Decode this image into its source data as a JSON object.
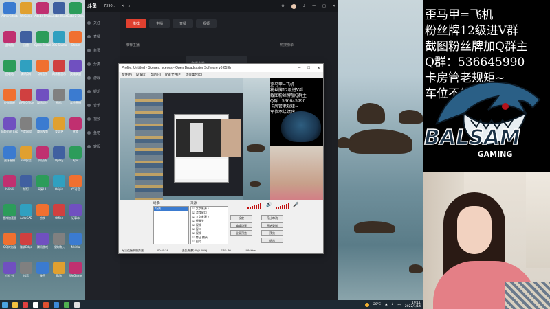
{
  "overlay": {
    "lines": [
      "歪马甲=飞机",
      "粉丝牌12级进V群",
      "截图粉丝牌加Q群主",
      "Q群：536645990",
      "卡房管老规矩~",
      "车位不给嫖哼"
    ],
    "logo_text": "BALSAM",
    "logo_sub": "GAMING"
  },
  "app": {
    "logo": "斗鱼",
    "title_code": "7390...",
    "sidebar": [
      "关注",
      "直播",
      "首页",
      "分类",
      "游戏",
      "娱乐",
      "音乐",
      "视频",
      "鱼吧",
      "客服"
    ],
    "tabs": [
      "推荐",
      "主播",
      "直播",
      "视频"
    ],
    "section_label": "推荐主播",
    "card_label": "自媒小桃",
    "right_label": "热搜榜单"
  },
  "obs": {
    "title": "Profile: Untitled - Scenes: scenes - Open Broadcaster Software v0.659b",
    "menu": [
      "文件(F)",
      "设置(S)",
      "帮助(H)",
      "配置文件(P)",
      "场景集合(C)"
    ],
    "scenes_label": "场景:",
    "sources_label": "来源:",
    "scenes": [
      "场景"
    ],
    "sources": [
      "文字来源 1",
      "游戏窗口",
      "文字来源 2",
      "摄像头",
      "视频",
      "窗口",
      "视频",
      "特征 捕获",
      "图片"
    ],
    "buttons": [
      "设定",
      "停止串流",
      "编辑场景",
      "开始录制",
      "全屏预览",
      "预览",
      "退出"
    ],
    "status": [
      "无法连接到服务器",
      "00:40:24",
      "丢失 帧数: 0 (0.00%)",
      "FPS: 30",
      "1094kb/s"
    ]
  },
  "taskbar": {
    "temperature": "20°C",
    "time": "19:11",
    "date": "2022/1/14"
  },
  "desktop": {
    "icons": [
      "Administrator",
      "WeGame",
      "Adobe Photoshop",
      "Adobe Illustr",
      "Dota 2 Steam",
      "此电脑",
      "迅雷",
      "Open Broadcaster",
      "OBS Studio",
      "Steam",
      "回收站",
      "腾讯QQ",
      "QQ音乐",
      "网易云音乐",
      "英雄联盟",
      "控制面板",
      "WPS Office",
      "腾讯会议",
      "微信",
      "斗鱼直播",
      "Internet Explorer",
      "百度网盘",
      "腾讯视频",
      "爱奇艺",
      "优酷",
      "虎牙直播",
      "360安全",
      "向日葵",
      "Uplay",
      "Epic",
      "bilibili",
      "钉钉",
      "网易UU",
      "Origin",
      "YY语音",
      "雷神加速器",
      "AutoCAD",
      "剪映",
      "Office",
      "记事本",
      "QQ浏览器",
      "微软Edge",
      "腾讯游戏",
      "搜狗输入",
      "Nvidia",
      "小红书",
      "抖音",
      "快手",
      "酷狗",
      "WeGame"
    ]
  }
}
